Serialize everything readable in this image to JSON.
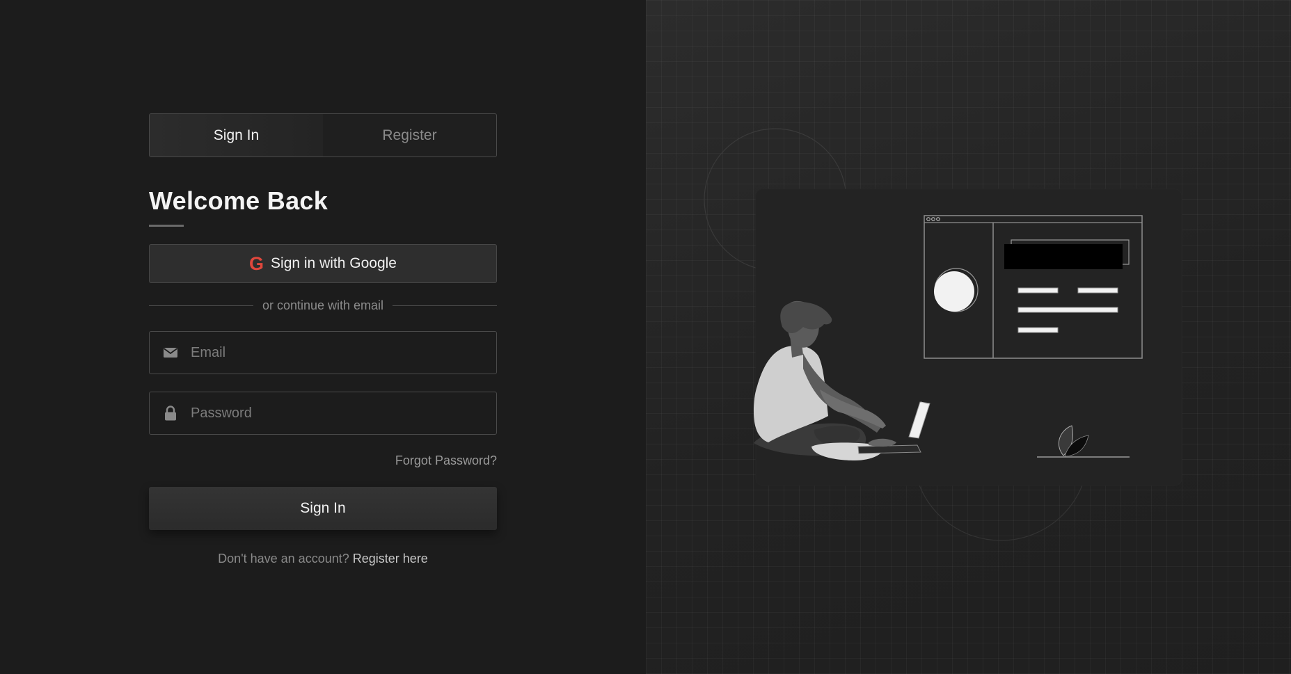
{
  "tabs": {
    "sign_in": "Sign In",
    "register": "Register"
  },
  "heading": "Welcome Back",
  "google_button": {
    "icon": "G",
    "label": "Sign in with Google"
  },
  "divider_text": "or continue with email",
  "email_field": {
    "placeholder": "Email",
    "value": ""
  },
  "password_field": {
    "placeholder": "Password",
    "value": ""
  },
  "forgot_password": "Forgot Password?",
  "submit_label": "Sign In",
  "footer": {
    "prompt": "Don't have an account?",
    "link": "Register here"
  },
  "colors": {
    "google_accent": "#e0473c",
    "background": "#1c1c1c"
  }
}
